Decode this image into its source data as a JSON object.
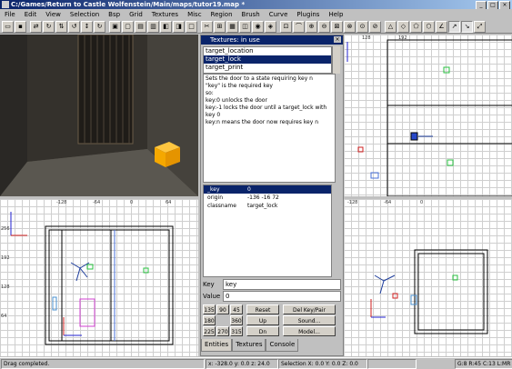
{
  "window": {
    "title": "C:/Games/Return to Castle Wolfenstein/Main/maps/tutor19.map *"
  },
  "menu": [
    "File",
    "Edit",
    "View",
    "Selection",
    "Bsp",
    "Grid",
    "Textures",
    "Misc",
    "Region",
    "Brush",
    "Curve",
    "Plugins",
    "Help"
  ],
  "camera": {
    "label": "3D camera view"
  },
  "textures_panel": {
    "title": "Textures: in use",
    "entity_list": [
      "target_location",
      "target_lock",
      "target_print"
    ],
    "selected_entity": "target_lock",
    "description": [
      "Sets the door to a state requiring key n",
      "\"key\" is the required key",
      "so:",
      "key:0  unlocks the door",
      "key:-1 locks the door until a target_lock with",
      "key 0",
      "key:n  means the door now requires key n"
    ],
    "properties": [
      {
        "key": "_key",
        "value": "0"
      },
      {
        "key": "origin",
        "value": "-136 -16 72"
      },
      {
        "key": "classname",
        "value": "target_lock"
      }
    ],
    "key_label": "Key",
    "key_value": "key",
    "value_label": "Value",
    "value_value": "0",
    "angle_buttons": [
      "135",
      "90",
      "45",
      "180",
      "360",
      "225",
      "270",
      "315"
    ],
    "action_buttons": [
      "Reset",
      "Up",
      "Dn"
    ],
    "right_buttons": [
      "Del Key/Pair",
      "Sound...",
      "Model..."
    ],
    "tabs": [
      "Entities",
      "Textures",
      "Console"
    ],
    "active_tab": "Entities"
  },
  "grid_labels": {
    "top": [
      "-128",
      "-64",
      "0",
      "64",
      "128",
      "192"
    ],
    "left": [
      "256",
      "192",
      "128",
      "64",
      "0"
    ]
  },
  "status": {
    "message": "Drag completed.",
    "coords": "x: -328.0  y: 0.0  z: 24.0",
    "selection": "Selection X: 0.0  Y: 0.0  Z: 0.0",
    "grid": "G:8 R:45 C:13 L:MR"
  },
  "colors": {
    "title_bar": "#0a246a",
    "selection": "#0a246a",
    "entity_box": "#f5a800",
    "grid_bg": "#ffffff"
  }
}
